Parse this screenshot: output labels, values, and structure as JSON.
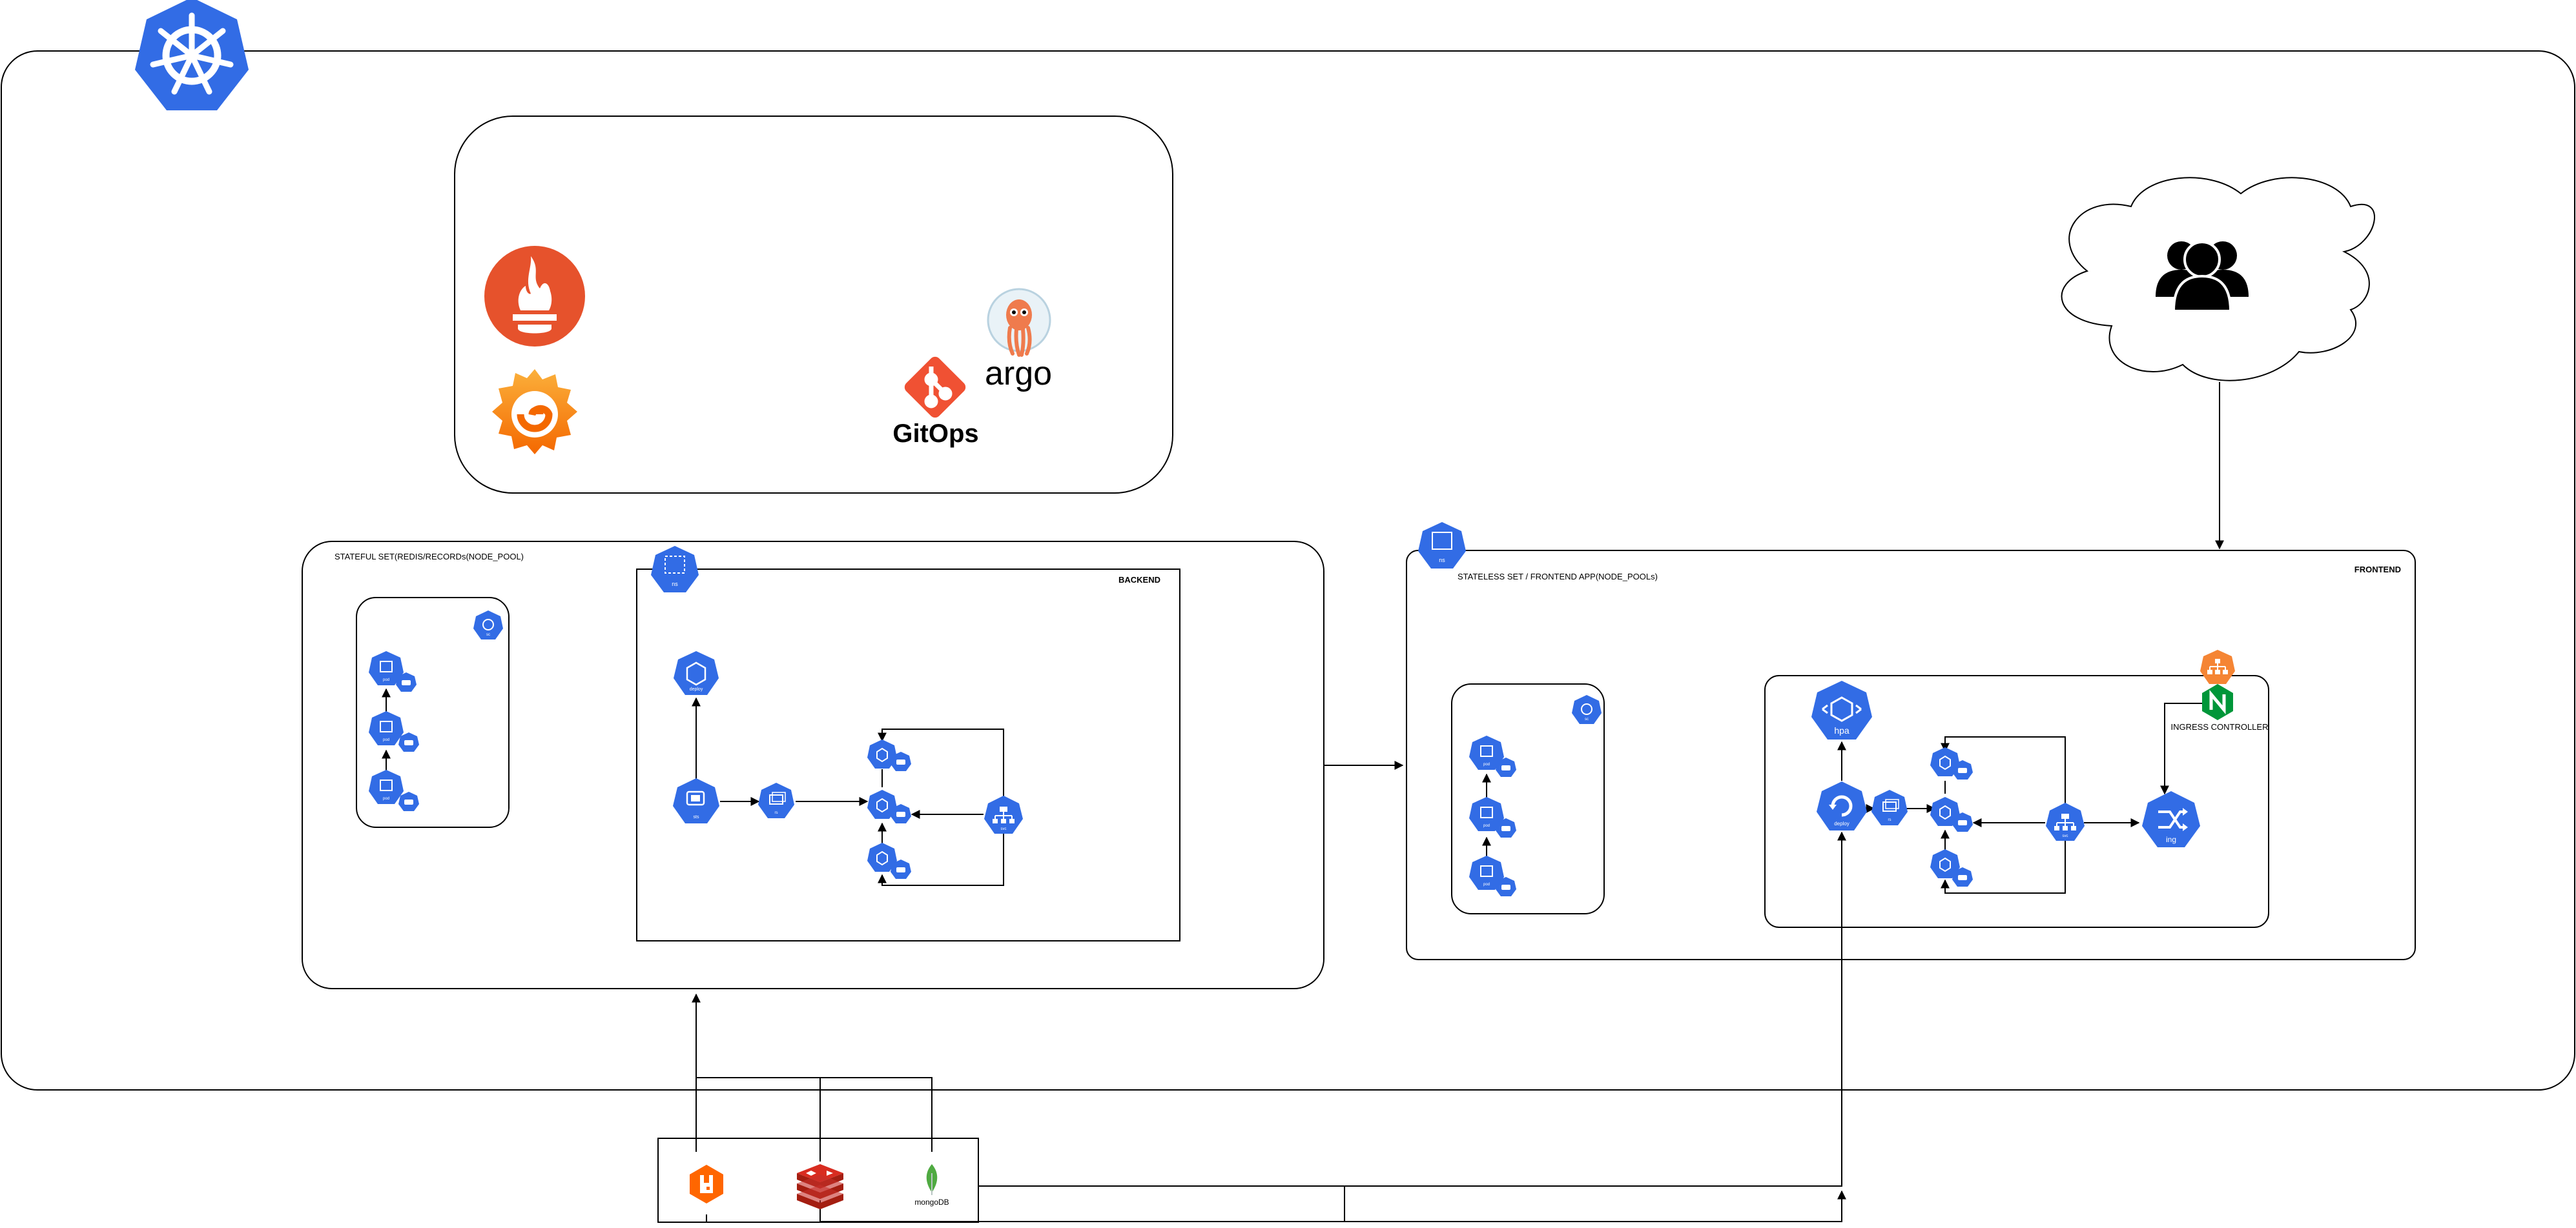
{
  "labels": {
    "stateful_set": "STATEFUL SET(REDIS/RECORDs(NODE_POOL)",
    "backend": "BACKEND",
    "stateless_set": "STATELESS SET / FRONTEND APP(NODE_POOLs)",
    "frontend": "FRONTEND",
    "ingress_controller": "INGRESS CONTROLLER",
    "gitops": "GitOps",
    "argo": "argo",
    "mongodb": "mongoDB"
  },
  "icons": {
    "ns": "ns",
    "deploy": "deploy",
    "hpa": "hpa",
    "rs": "rs",
    "svc": "svc",
    "ing": "ing",
    "sts": "sts",
    "pod": "pod",
    "sc": "sc"
  },
  "colors": {
    "k8s_blue": "#326ce5",
    "prometheus": "#e6522c",
    "grafana_orange": "#f46800",
    "grafana_yellow": "#fbb03b",
    "git": "#f05133",
    "argo": "#ef7b4d",
    "redis": "#c6302b",
    "rabbitmq": "#ff6600",
    "mongodb": "#4faa41",
    "nginx": "#009639",
    "lb_orange": "#f58534"
  }
}
